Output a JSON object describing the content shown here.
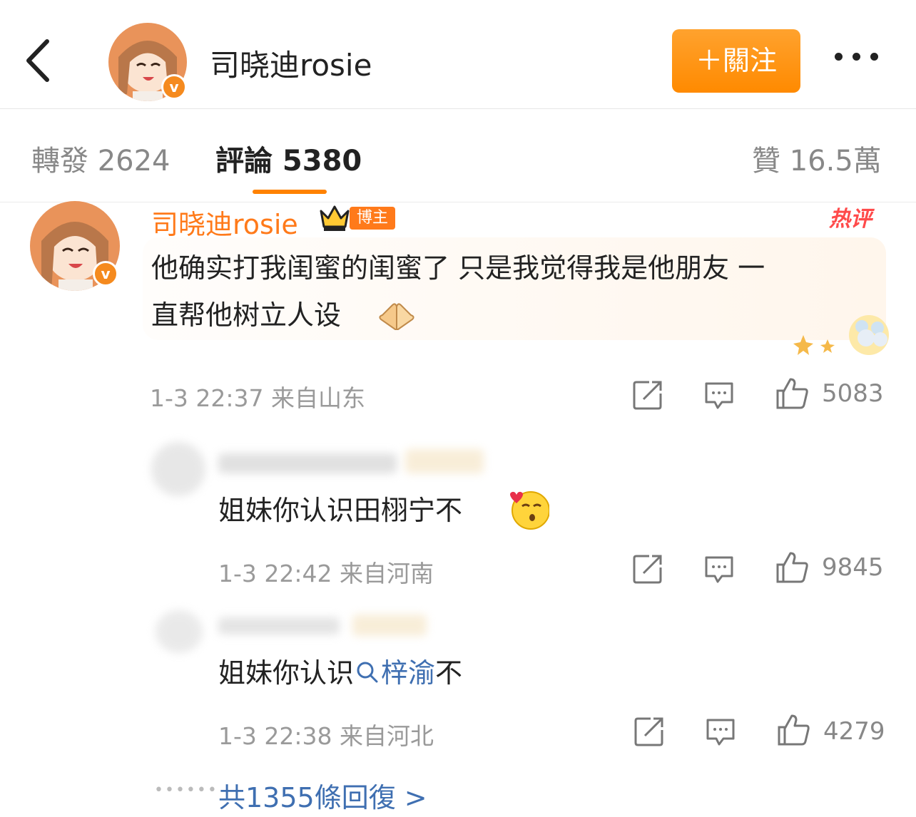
{
  "header": {
    "title": "司晓迪rosie",
    "follow_label": "＋關注"
  },
  "tabs": [
    {
      "label": "轉發 2624"
    },
    {
      "label": "評論 5380"
    },
    {
      "label": "贊 16.5萬"
    }
  ],
  "comments": [
    {
      "username": "司晓迪rosie",
      "badge": "博主",
      "hot_tag": "热评",
      "text_line1": "他确实打我闺蜜的闺蜜了 只是我觉得我是他朋友 一",
      "text_line2": "直帮他树立人设",
      "meta": "1-3 22:37 来自山东",
      "likes": "5083"
    },
    {
      "text_part1": "姐妹你认识田栩宁不",
      "meta": "1-3 22:42 来自河南",
      "likes": "9845"
    },
    {
      "text_part1": "姐妹你认识",
      "topic": "梓渝",
      "text_part2": "不",
      "meta": "1-3 22:38 来自河北",
      "likes": "4279"
    }
  ],
  "more_replies": "共1355條回復 >",
  "colors": {
    "accent": "#ff8200",
    "username": "#ff7a1a",
    "link": "#3f6fb1",
    "hot": "#ff4a4a"
  },
  "icons": [
    "back-arrow-icon",
    "more-icon",
    "crown-icon",
    "repost-icon",
    "comment-icon",
    "like-icon",
    "search-icon",
    "blush-kiss-emoji-icon",
    "praying-hands-emoji-icon"
  ]
}
